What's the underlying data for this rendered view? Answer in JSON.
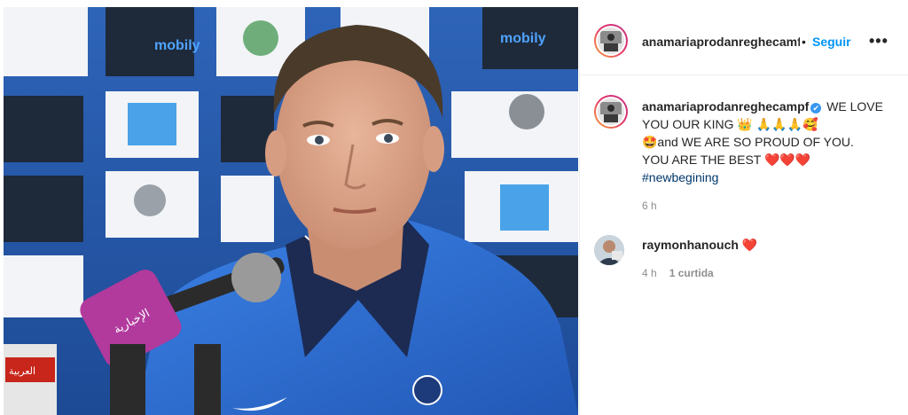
{
  "post": {
    "username": "anamariaprodanreghecamf",
    "separator": "•",
    "follow_label": "Seguir",
    "more_label": "•••"
  },
  "caption": {
    "username": "anamariaprodanreghecampf",
    "line1": "WE LOVE YOU OUR KING 👑 🙏🙏🙏🥰",
    "line2": "🤩and WE ARE SO PROUD OF YOU.",
    "line3": "YOU ARE THE BEST ❤️❤️❤️",
    "hashtag": "#newbegining",
    "time": "6 h"
  },
  "comment": {
    "username": "raymonhanouch",
    "text": "❤️",
    "time": "4 h",
    "likes": "1 curtida"
  },
  "photo": {
    "sponsor_text_1": "mobily",
    "sponsor_text_2": "mobily",
    "mic_label_1": "الإخبارية",
    "mic_label_2": "العربية"
  },
  "colors": {
    "accent": "#0095f6",
    "verified": "#3897f0",
    "hashtag": "#00376b",
    "muted": "#8e8e8e",
    "jersey": "#2f6fd1"
  }
}
